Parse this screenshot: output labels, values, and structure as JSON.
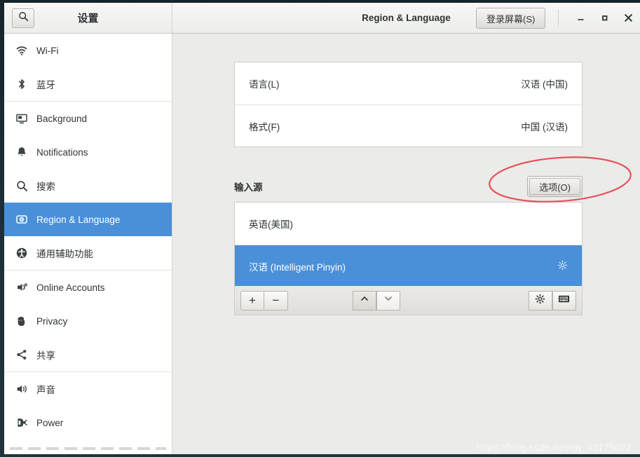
{
  "window": {
    "app_title": "设置",
    "panel_title": "Region & Language",
    "login_screen_button": "登录屏幕(S)",
    "login_screen_mnemonic": "S",
    "search_icon": "search-icon",
    "minimize_label": "_",
    "maximize_label": "□",
    "close_label": "×"
  },
  "sidebar": {
    "items": [
      {
        "label": "Wi-Fi",
        "icon": "wifi-icon",
        "selected": false
      },
      {
        "label": "蓝牙",
        "icon": "bluetooth-icon",
        "selected": false
      },
      {
        "label": "Background",
        "icon": "monitor-icon",
        "selected": false
      },
      {
        "label": "Notifications",
        "icon": "bell-icon",
        "selected": false
      },
      {
        "label": "搜索",
        "icon": "search-icon",
        "selected": false
      },
      {
        "label": "Region & Language",
        "icon": "globe-icon",
        "selected": true
      },
      {
        "label": "通用辅助功能",
        "icon": "accessibility-icon",
        "selected": false
      },
      {
        "label": "Online Accounts",
        "icon": "online-accounts-icon",
        "selected": false
      },
      {
        "label": "Privacy",
        "icon": "hand-icon",
        "selected": false
      },
      {
        "label": "共享",
        "icon": "share-icon",
        "selected": false
      },
      {
        "label": "声音",
        "icon": "speaker-icon",
        "selected": false
      },
      {
        "label": "Power",
        "icon": "power-plug-icon",
        "selected": false
      }
    ]
  },
  "main": {
    "language_rows": [
      {
        "label": "语言(L)",
        "mnemonic": "L",
        "value": "汉语 (中国)"
      },
      {
        "label": "格式(F)",
        "mnemonic": "F",
        "value": "中国 (汉语)"
      }
    ],
    "input_sources": {
      "heading": "输入源",
      "options_button": "选项(O)",
      "options_mnemonic": "O",
      "items": [
        {
          "label": "英语(美国)",
          "selected": false,
          "has_gear": false
        },
        {
          "label": "汉语 (Intelligent Pinyin)",
          "selected": true,
          "has_gear": true
        }
      ],
      "toolbar": {
        "add_label": "+",
        "remove_label": "−",
        "move_up_icon": "chevron-up-icon",
        "move_down_icon": "chevron-down-icon",
        "settings_icon": "gear-icon",
        "keyboard_icon": "keyboard-icon"
      }
    }
  },
  "annotation": {
    "shape": "red-ellipse-highlight"
  },
  "watermark": {
    "text": "https://blog.csdn.net/qq_43175022"
  },
  "colors": {
    "selection_blue": "#4a90d9",
    "annotation_red": "#e8505a",
    "panel_bg": "#ebebe9",
    "desktop_bg": "#1d2b33"
  }
}
